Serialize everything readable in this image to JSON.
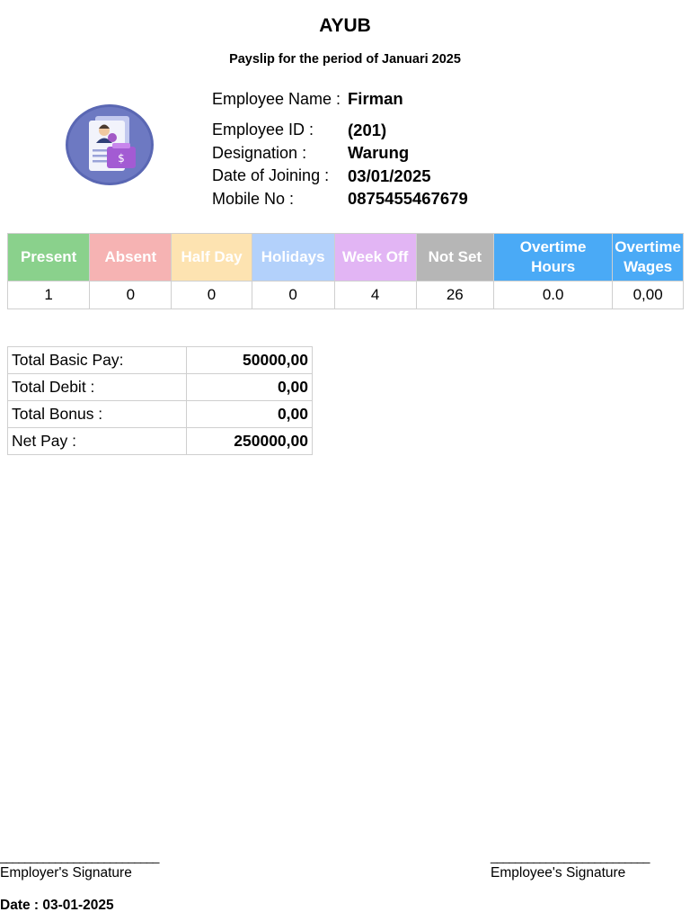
{
  "header": {
    "company": "AYUB",
    "period": "Payslip for the period of Januari 2025"
  },
  "employee": {
    "name_label": "Employee Name :",
    "name": "Firman",
    "id_label": "Employee ID :",
    "id": "(201)",
    "designation_label": "Designation :",
    "designation": "Warung",
    "joining_label": "Date of Joining :",
    "joining": "03/01/2025",
    "mobile_label": "Mobile No :",
    "mobile": "0875455467679"
  },
  "attendance": {
    "headers": [
      {
        "label": "Present",
        "color": "#8ad18c"
      },
      {
        "label": "Absent",
        "color": "#f6b3b3"
      },
      {
        "label": "Half Day",
        "color": "#fde3b1"
      },
      {
        "label": "Holidays",
        "color": "#b3d1fb"
      },
      {
        "label": "Week Off",
        "color": "#e2b5f4"
      },
      {
        "label": "Not Set",
        "color": "#b6b6b6"
      },
      {
        "label": "Overtime Hours",
        "color": "#4aaaf6"
      },
      {
        "label": "Overtime Wages",
        "color": "#4aaaf6"
      }
    ],
    "values": [
      "1",
      "0",
      "0",
      "0",
      "4",
      "26",
      "0.0",
      "0,00"
    ]
  },
  "summary": [
    {
      "label": "Total Basic Pay:",
      "value": "50000,00"
    },
    {
      "label": "Total Debit :",
      "value": "0,00"
    },
    {
      "label": "Total Bonus :",
      "value": "0,00"
    },
    {
      "label": "Net Pay :",
      "value": "250000,00"
    }
  ],
  "footer": {
    "line": "__________________________",
    "employer_signature": "Employer's Signature",
    "employee_signature": "Employee's Signature",
    "date": "Date : 03-01-2025"
  },
  "icons": {
    "avatar": "employee-id-card-icon"
  }
}
